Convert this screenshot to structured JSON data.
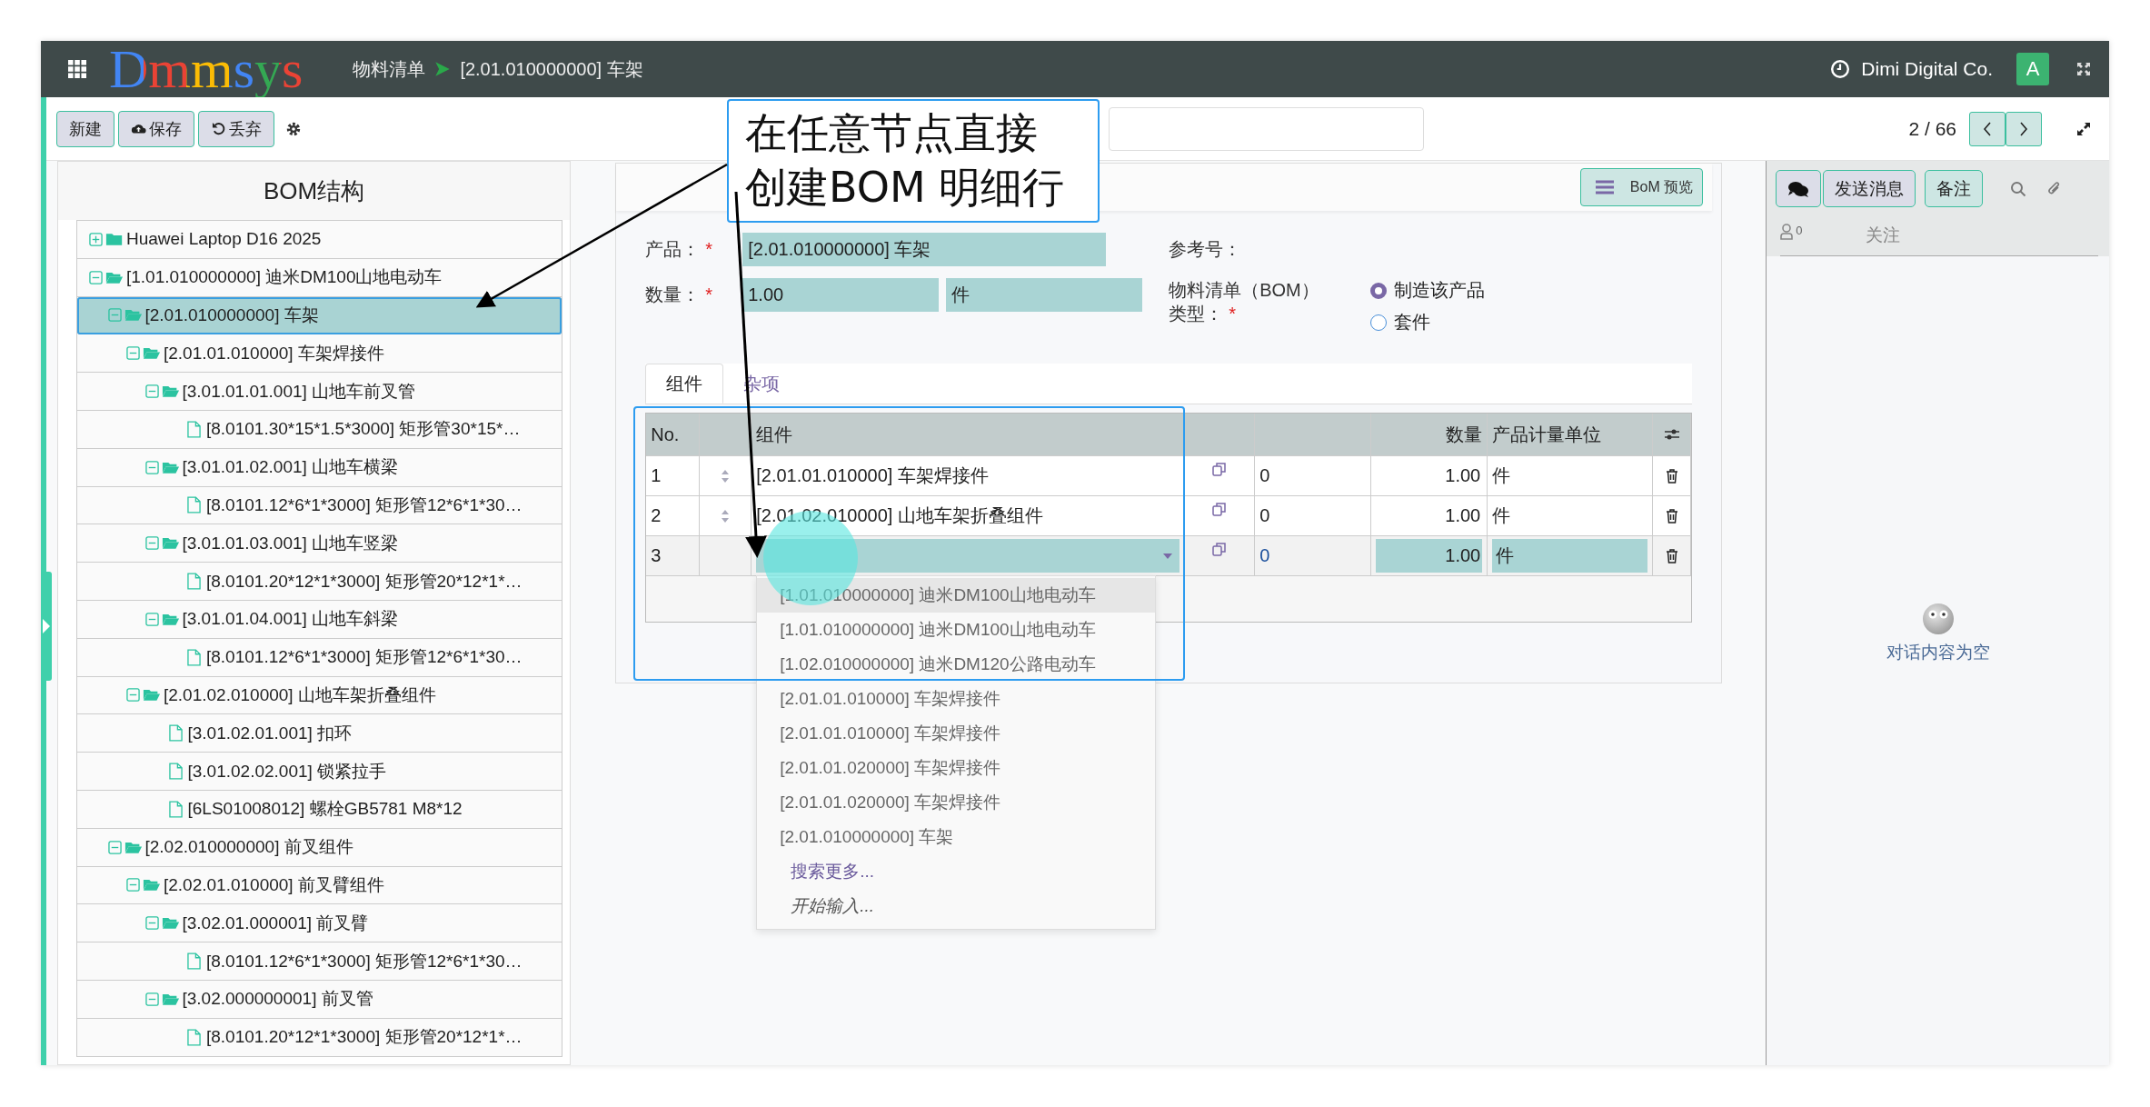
{
  "topbar": {
    "app_name": "Dmmsys",
    "breadcrumb": [
      {
        "label": "物料清单"
      },
      {
        "label": "[2.01.010000000] 车架"
      }
    ],
    "company": "Dimi Digital Co.",
    "avatar": "A"
  },
  "toolbar": {
    "buttons": [
      {
        "label": "新建",
        "kind": "plain"
      },
      {
        "label": "保存",
        "kind": "save"
      },
      {
        "label": "丢弃",
        "kind": "discard"
      }
    ],
    "pager": "2 / 66"
  },
  "bom_tree": {
    "title": "BOM结构",
    "nodes": [
      {
        "label": "Huawei Laptop D16 2025",
        "kind": "folder",
        "expanded": false,
        "selected": false
      },
      {
        "label": "[1.01.010000000] 迪米DM100山地电动车",
        "kind": "folder",
        "expanded": true,
        "selected": false,
        "children": [
          {
            "label": "[2.01.010000000] 车架",
            "kind": "folder",
            "expanded": true,
            "selected": true,
            "children": [
              {
                "label": "[2.01.01.010000] 车架焊接件",
                "kind": "folder",
                "expanded": true,
                "selected": false,
                "children": [
                  {
                    "label": "[3.01.01.01.001] 山地车前叉管",
                    "kind": "folder",
                    "expanded": true,
                    "selected": false,
                    "children": [
                      {
                        "label": "[8.0101.30*15*1.5*3000] 矩形管30*15*…",
                        "kind": "file",
                        "selected": false
                      }
                    ]
                  },
                  {
                    "label": "[3.01.01.02.001] 山地车横梁",
                    "kind": "folder",
                    "expanded": true,
                    "selected": false,
                    "children": [
                      {
                        "label": "[8.0101.12*6*1*3000] 矩形管12*6*1*30…",
                        "kind": "file",
                        "selected": false
                      }
                    ]
                  },
                  {
                    "label": "[3.01.01.03.001] 山地车竖梁",
                    "kind": "folder",
                    "expanded": true,
                    "selected": false,
                    "children": [
                      {
                        "label": "[8.0101.20*12*1*3000] 矩形管20*12*1*…",
                        "kind": "file",
                        "selected": false
                      }
                    ]
                  },
                  {
                    "label": "[3.01.01.04.001] 山地车斜梁",
                    "kind": "folder",
                    "expanded": true,
                    "selected": false,
                    "children": [
                      {
                        "label": "[8.0101.12*6*1*3000] 矩形管12*6*1*30…",
                        "kind": "file",
                        "selected": false
                      }
                    ]
                  }
                ]
              },
              {
                "label": "[2.01.02.010000] 山地车架折叠组件",
                "kind": "folder",
                "expanded": true,
                "selected": false,
                "children": [
                  {
                    "label": "[3.01.02.01.001] 扣环",
                    "kind": "file",
                    "selected": false
                  },
                  {
                    "label": "[3.01.02.02.001] 锁紧拉手",
                    "kind": "file",
                    "selected": false
                  },
                  {
                    "label": "[6LS01008012] 螺栓GB5781 M8*12",
                    "kind": "file",
                    "selected": false
                  }
                ]
              }
            ]
          },
          {
            "label": "[2.02.010000000] 前叉组件",
            "kind": "folder",
            "expanded": true,
            "selected": false,
            "children": [
              {
                "label": "[2.02.01.010000] 前叉臂组件",
                "kind": "folder",
                "expanded": true,
                "selected": false,
                "children": [
                  {
                    "label": "[3.02.01.000001] 前叉臂",
                    "kind": "folder",
                    "expanded": true,
                    "selected": false,
                    "children": [
                      {
                        "label": "[8.0101.12*6*1*3000] 矩形管12*6*1*30…",
                        "kind": "file",
                        "selected": false
                      }
                    ]
                  },
                  {
                    "label": "[3.02.000000001] 前叉管",
                    "kind": "folder",
                    "expanded": true,
                    "selected": false,
                    "children": [
                      {
                        "label": "[8.0101.20*12*1*3000] 矩形管20*12*1*…",
                        "kind": "file",
                        "selected": false
                      }
                    ]
                  }
                ]
              }
            ]
          }
        ]
      }
    ]
  },
  "form": {
    "preview_button": "BoM 预览",
    "product": {
      "label": "产品：",
      "required_mark": "*",
      "value": "[2.01.010000000] 车架"
    },
    "quantity": {
      "label": "数量：",
      "required_mark": "*",
      "value": "1.00",
      "unit": "件"
    },
    "reference": {
      "label": "参考号："
    },
    "bom_type": {
      "label": "物料清单（BOM）类型：",
      "required_mark": "*",
      "options": [
        {
          "label": "制造该产品",
          "selected": true
        },
        {
          "label": "套件",
          "selected": false
        }
      ]
    },
    "tabs": [
      {
        "label": "组件",
        "selected": true
      },
      {
        "label": "杂项",
        "selected": false
      }
    ],
    "table": {
      "columns": {
        "no": "No.",
        "component": "组件",
        "quantity": "数量",
        "uom": "产品计量单位"
      },
      "rows": [
        {
          "no": "1",
          "component": "[2.01.01.010000] 车架焊接件",
          "column_5": "0",
          "quantity": "1.00",
          "uom": "件",
          "editing": false
        },
        {
          "no": "2",
          "component": "[2.01.02.010000] 山地车架折叠组件",
          "column_5": "0",
          "quantity": "1.00",
          "uom": "件",
          "editing": false
        },
        {
          "no": "3",
          "column_5": "0",
          "quantity": "1.00",
          "uom": "件",
          "editing": true
        }
      ]
    },
    "dropdown": {
      "options": [
        {
          "label": "[1.01.010000000] 迪米DM100山地电动车",
          "selected": true
        },
        {
          "label": "[1.01.010000000] 迪米DM100山地电动车",
          "selected": false
        },
        {
          "label": "[1.02.010000000] 迪米DM120公路电动车",
          "selected": false
        },
        {
          "label": "[2.01.01.010000] 车架焊接件",
          "selected": false
        },
        {
          "label": "[2.01.01.010000] 车架焊接件",
          "selected": false
        },
        {
          "label": "[2.01.01.020000] 车架焊接件",
          "selected": false
        },
        {
          "label": "[2.01.01.020000] 车架焊接件",
          "selected": false
        },
        {
          "label": "[2.01.010000000] 车架",
          "selected": false
        }
      ],
      "search_more": "搜索更多...",
      "start_typing": "开始输入..."
    }
  },
  "chatter": {
    "buttons": [
      {
        "label": "发送消息"
      },
      {
        "label": "备注"
      }
    ],
    "followers_count": "0",
    "follow": "关注",
    "empty_message": "对话内容为空"
  },
  "annotation": {
    "lines": [
      "在任意节点直接",
      "创建BOM 明细行"
    ]
  }
}
